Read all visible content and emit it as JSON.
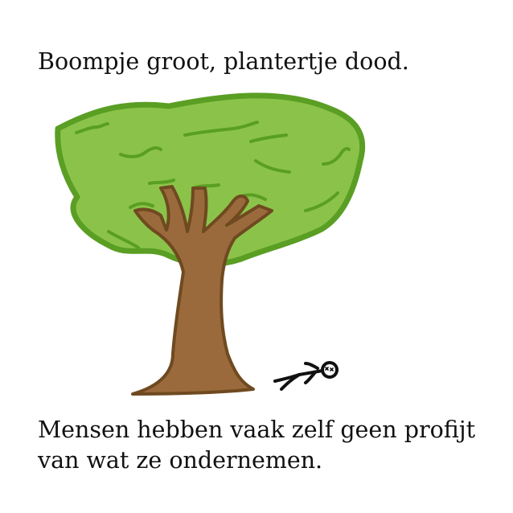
{
  "title": "Boompje groot, plantertje dood.",
  "body": "Mensen hebben vaak zelf geen profijt van wat ze ondernemen.",
  "colors": {
    "foliage": "#8bc34a",
    "foliage_outline": "#5a9e24",
    "trunk": "#9b6a3c",
    "trunk_outline": "#6f4a20",
    "figure": "#111111",
    "text": "#111111"
  },
  "illustration": {
    "subject": "tree-with-fallen-stick-figure",
    "figure_state": "dead"
  }
}
